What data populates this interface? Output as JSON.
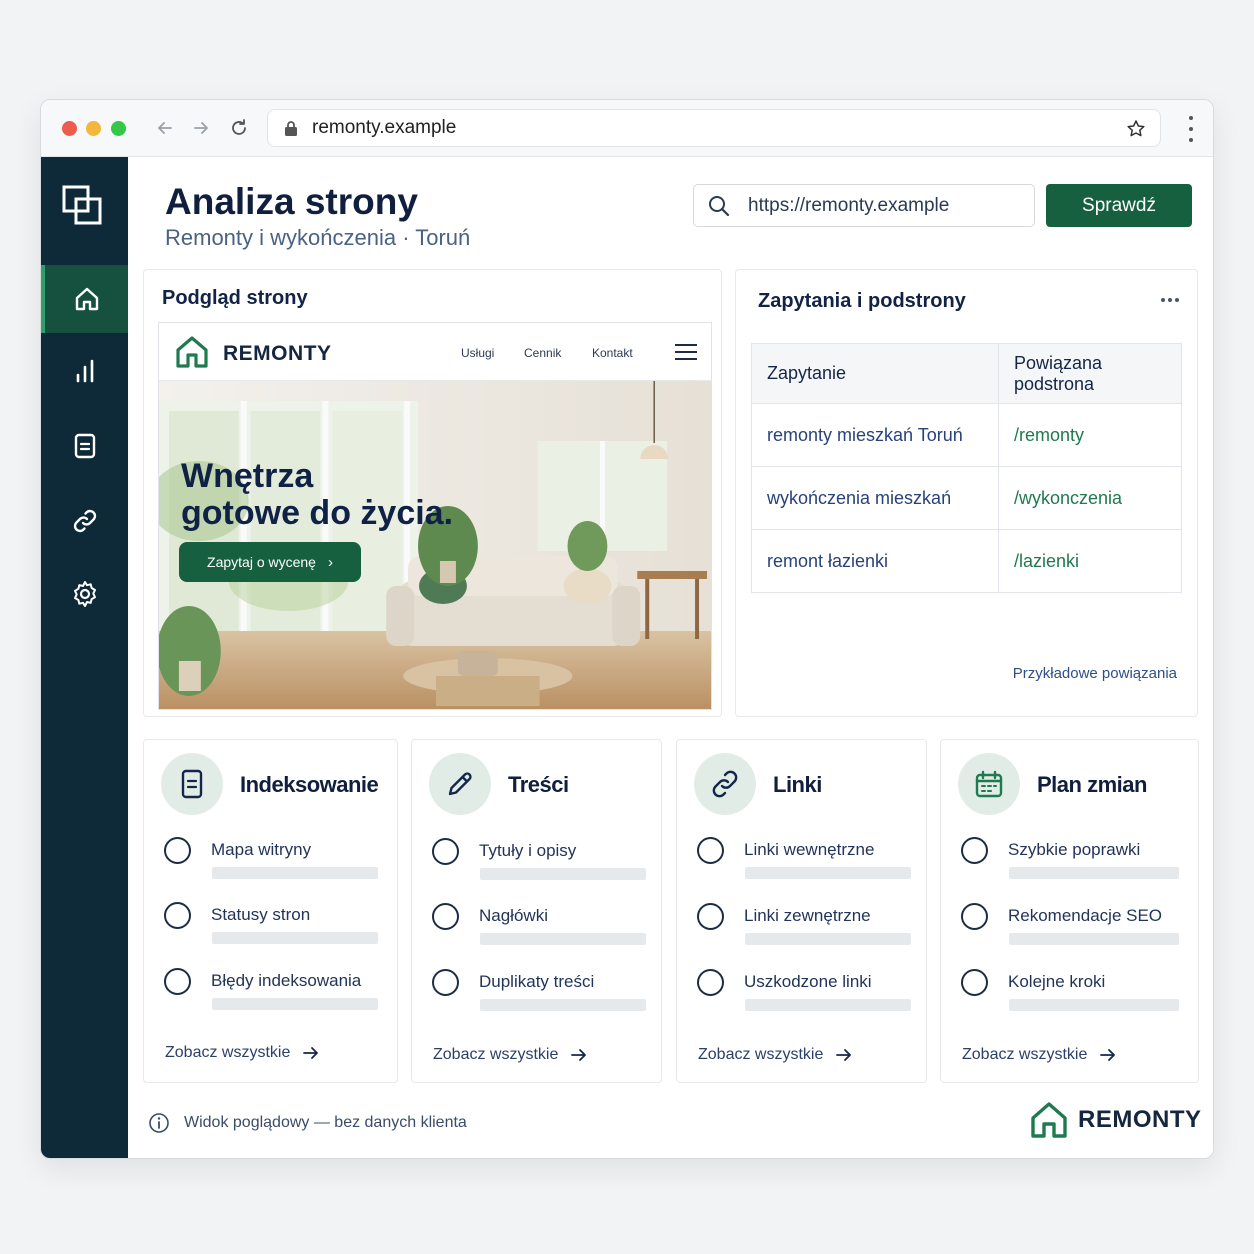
{
  "browser": {
    "url": "remonty.example"
  },
  "header": {
    "title": "Analiza strony",
    "subtitle": "Remonty i wykończenia · Toruń",
    "search_value": "https://remonty.example",
    "check_label": "Sprawdź"
  },
  "sidebar": {
    "items": [
      {
        "icon": "home-icon",
        "active": true
      },
      {
        "icon": "bar-chart-icon",
        "active": false
      },
      {
        "icon": "document-icon",
        "active": false
      },
      {
        "icon": "link-icon",
        "active": false
      },
      {
        "icon": "gear-icon",
        "active": false
      }
    ]
  },
  "preview": {
    "title": "Podgląd strony",
    "site_logo": "REMONTY",
    "nav": [
      "Usługi",
      "Cennik",
      "Kontakt"
    ],
    "headline_line1": "Wnętrza",
    "headline_line2": "gotowe do życia.",
    "cta": "Zapytaj o wycenę"
  },
  "queries": {
    "title": "Zapytania i podstrony",
    "columns": [
      "Zapytanie",
      "Powiązana podstrona"
    ],
    "rows": [
      [
        "remonty mieszkań Toruń",
        "/remonty"
      ],
      [
        "wykończenia mieszkań",
        "/wykonczenia"
      ],
      [
        "remont łazienki",
        "/lazienki"
      ]
    ],
    "footnote": "Przykładowe powiązania"
  },
  "cards": [
    {
      "title": "Indeksowanie",
      "icon": "document-icon",
      "items": [
        "Mapa witryny",
        "Statusy stron",
        "Błędy indeksowania"
      ],
      "link": "Zobacz wszystkie"
    },
    {
      "title": "Treści",
      "icon": "pencil-icon",
      "items": [
        "Tytuły i opisy",
        "Nagłówki",
        "Duplikaty treści"
      ],
      "link": "Zobacz wszystkie"
    },
    {
      "title": "Linki",
      "icon": "link-icon",
      "items": [
        "Linki wewnętrzne",
        "Linki zewnętrzne",
        "Uszkodzone linki"
      ],
      "link": "Zobacz wszystkie"
    },
    {
      "title": "Plan zmian",
      "icon": "calendar-icon",
      "items": [
        "Szybkie poprawki",
        "Rekomendacje SEO",
        "Kolejne kroki"
      ],
      "link": "Zobacz wszystkie"
    }
  ],
  "footer": {
    "info": "Widok poglądowy — bez danych klienta",
    "brand": "REMONTY"
  },
  "colors": {
    "sidebar": "#0e2a38",
    "accent": "#17603f",
    "active_item": "#16503f"
  }
}
